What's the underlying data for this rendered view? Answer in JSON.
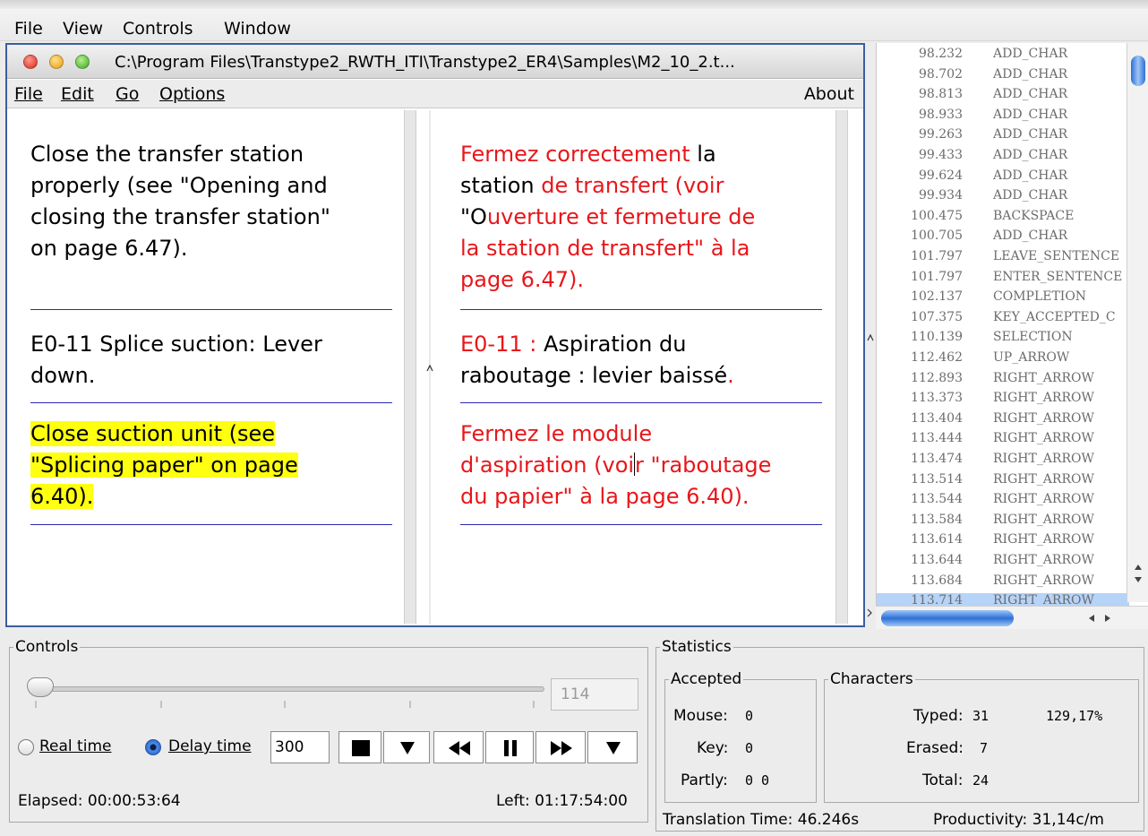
{
  "app_menu": [
    "File",
    "View",
    "Controls",
    "Window"
  ],
  "window": {
    "title": "C:\\Program Files\\Transtype2_RWTH_ITI\\Transtype2_ER4\\Samples\\M2_10_2.t...",
    "menu": [
      "File",
      "Edit",
      "Go",
      "Options"
    ],
    "about": "About"
  },
  "source": [
    [
      "Close the transfer station",
      "properly (see \"Opening and",
      "closing the transfer station\"",
      "on page 6.47)."
    ],
    [
      "E0-11 Splice suction: Lever",
      "down."
    ],
    [
      "Close suction unit (see",
      "\"Splicing paper\" on page",
      "6.40)."
    ]
  ],
  "target": {
    "seg1": [
      [
        [
          "Fermez correctement",
          "r"
        ],
        [
          " l",
          "b"
        ],
        [
          "a",
          "b"
        ]
      ],
      [
        [
          "station ",
          "b"
        ],
        [
          "de transfert (voir",
          "r"
        ]
      ],
      [
        [
          "\"O",
          "b"
        ],
        [
          "uverture et fermeture de",
          "r"
        ]
      ],
      [
        [
          "la station de transfert\" à la",
          "r"
        ]
      ],
      [
        [
          "page 6.47).",
          "r"
        ]
      ]
    ],
    "seg2": [
      [
        [
          "E0-11",
          "r"
        ],
        [
          " : ",
          "r"
        ],
        [
          "Aspiration du",
          "b"
        ]
      ],
      [
        [
          "raboutage : levier baissé",
          "b"
        ],
        [
          ".",
          "r"
        ]
      ]
    ],
    "seg3": [
      [
        [
          "Fermez le module",
          "r"
        ]
      ],
      [
        [
          "d'aspiration (voi",
          "r"
        ],
        [
          "r \"raboutage",
          "r"
        ]
      ],
      [
        [
          "du papier\" à la page 6.40).",
          "r"
        ]
      ]
    ]
  },
  "log": [
    [
      "98.232",
      "ADD_CHAR"
    ],
    [
      "98.702",
      "ADD_CHAR"
    ],
    [
      "98.813",
      "ADD_CHAR"
    ],
    [
      "98.933",
      "ADD_CHAR"
    ],
    [
      "99.263",
      "ADD_CHAR"
    ],
    [
      "99.433",
      "ADD_CHAR"
    ],
    [
      "99.624",
      "ADD_CHAR"
    ],
    [
      "99.934",
      "ADD_CHAR"
    ],
    [
      "100.475",
      "BACKSPACE"
    ],
    [
      "100.705",
      "ADD_CHAR"
    ],
    [
      "101.797",
      "LEAVE_SENTENCE"
    ],
    [
      "101.797",
      "ENTER_SENTENCE"
    ],
    [
      "102.137",
      "COMPLETION"
    ],
    [
      "107.375",
      "KEY_ACCEPTED_C"
    ],
    [
      "110.139",
      "SELECTION"
    ],
    [
      "112.462",
      "UP_ARROW"
    ],
    [
      "112.893",
      "RIGHT_ARROW"
    ],
    [
      "113.373",
      "RIGHT_ARROW"
    ],
    [
      "113.404",
      "RIGHT_ARROW"
    ],
    [
      "113.444",
      "RIGHT_ARROW"
    ],
    [
      "113.474",
      "RIGHT_ARROW"
    ],
    [
      "113.514",
      "RIGHT_ARROW"
    ],
    [
      "113.544",
      "RIGHT_ARROW"
    ],
    [
      "113.584",
      "RIGHT_ARROW"
    ],
    [
      "113.614",
      "RIGHT_ARROW"
    ],
    [
      "113.644",
      "RIGHT_ARROW"
    ],
    [
      "113.684",
      "RIGHT_ARROW"
    ],
    [
      "113.714",
      "RIGHT_ARROW"
    ]
  ],
  "log_selected_index": 27,
  "controls": {
    "legend": "Controls",
    "slider_value": "114",
    "real_time": "Real time",
    "delay_time": "Delay time",
    "delay_value": "300",
    "elapsed": "Elapsed: 00:00:53:64",
    "left": "Left: 01:17:54:00"
  },
  "stats": {
    "legend": "Statistics",
    "accepted_legend": "Accepted",
    "mouse_label": "Mouse:",
    "mouse": "0",
    "key_label": "Key:",
    "key": "0",
    "partly_label": "Partly:",
    "partly": "0 0",
    "characters_legend": "Characters",
    "typed_label": "Typed:",
    "typed": "31",
    "typed_pct": "129,17%",
    "erased_label": "Erased:",
    "erased": "7",
    "total_label": "Total:",
    "total": "24",
    "translation_time": "Translation Time: 46.246s",
    "productivity": "Productivity: 31,14c/m"
  },
  "colors": {
    "accent_red": "#e8161a",
    "highlight": "#ffff10",
    "separator": "#2a2ab0",
    "selection": "#b6d3f8"
  }
}
